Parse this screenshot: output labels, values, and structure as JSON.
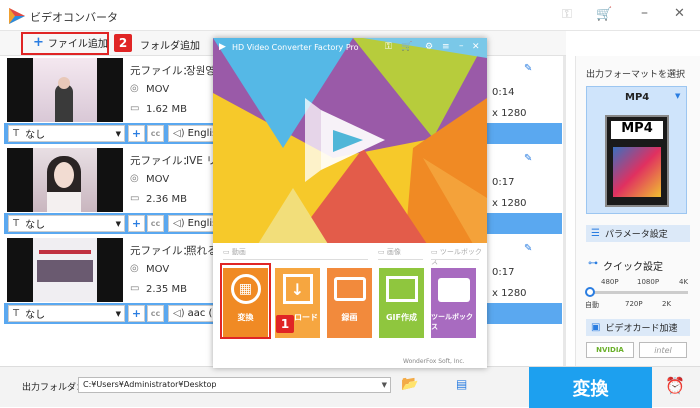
{
  "app": {
    "title": "ビデオコンバータ"
  },
  "toolbar": {
    "add_file": "ファイル追加",
    "add_folder": "フォルダ追加"
  },
  "files": [
    {
      "source_label": "元ファイル：",
      "source_name": "장원영이",
      "format": "MOV",
      "size": "1.62 MB",
      "subtitle": "なし",
      "audio": "Englis",
      "duration": "0:14",
      "resolution": "x 1280"
    },
    {
      "source_label": "元ファイル：",
      "source_name": "IVE リ",
      "format": "MOV",
      "size": "2.36 MB",
      "subtitle": "なし",
      "audio": "Englis",
      "duration": "0:17",
      "resolution": "x 1280"
    },
    {
      "source_label": "元ファイル：",
      "source_name": "照れる",
      "format": "MOV",
      "size": "2.35 MB",
      "subtitle": "なし",
      "audio": "aac (",
      "duration": "0:17",
      "resolution": "x 1280"
    }
  ],
  "overlay": {
    "title": "HD Video Converter Factory Pro",
    "sec_video": "動画",
    "sec_image": "画像",
    "sec_toolbox": "ツールボックス",
    "tools": [
      "変換",
      "ダウンロード",
      "録画",
      "GIF作成",
      "ツールボックス"
    ],
    "footer": "WonderFox Soft, Inc.",
    "visible_download": "ロード"
  },
  "right": {
    "format_title": "出力フォーマットを選択",
    "format": "MP4",
    "param_btn": "パラメータ設定",
    "quick_title": "クイック設定",
    "quality_top": [
      "480P",
      "1080P",
      "4K"
    ],
    "quality_bottom": [
      "自動",
      "720P",
      "2K"
    ],
    "gpu_btn": "ビデオカード加速",
    "nvidia": "NVIDIA",
    "intel": "intel"
  },
  "bottom": {
    "out_label": "出力フォルダ：",
    "out_path": "C:¥Users¥Administrator¥Desktop",
    "convert": "変換"
  },
  "annotations": {
    "step1": "1",
    "step2": "2"
  },
  "colors": {
    "accent": "#2a7de1",
    "convert_bg": "#1da0ef",
    "highlight": "#e02525"
  }
}
